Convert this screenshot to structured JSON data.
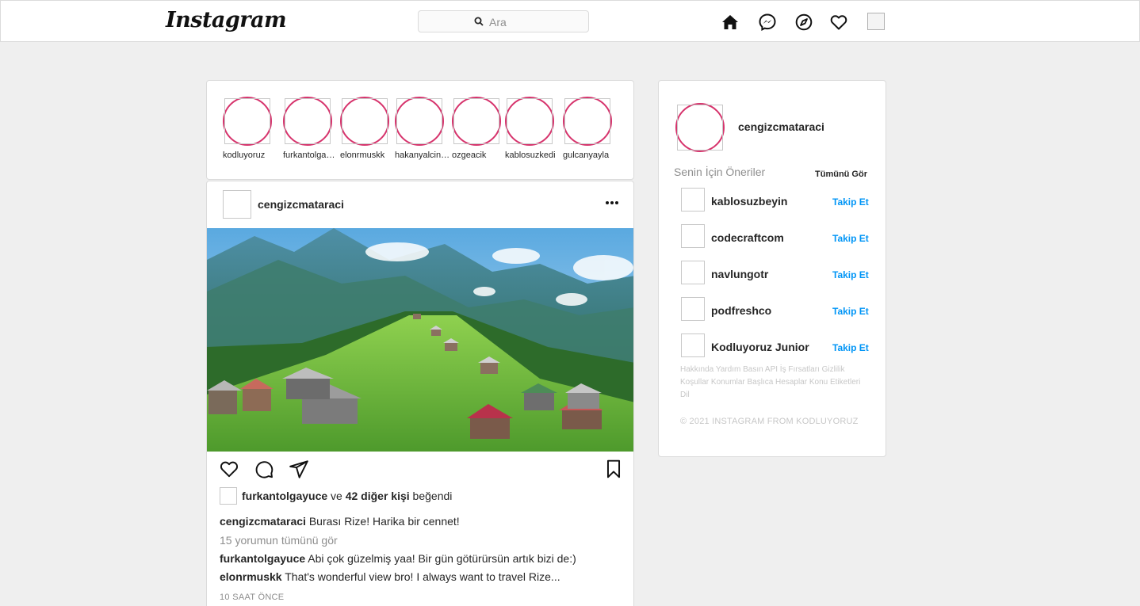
{
  "header": {
    "logo": "Instagram",
    "search_placeholder": "Ara"
  },
  "stories": [
    {
      "name": "kodluyoruz"
    },
    {
      "name": "furkantolgayuce"
    },
    {
      "name": "elonrmuskk"
    },
    {
      "name": "hakanyalcinkaya"
    },
    {
      "name": "ozgeacik"
    },
    {
      "name": "kablosuzkedi"
    },
    {
      "name": "gulcanyayla"
    }
  ],
  "post": {
    "author": "cengizcmataraci",
    "liked_by": "furkantolgayuce",
    "likes_and": "ve",
    "likes_others": "42 diğer kişi",
    "likes_suffix": "beğendi",
    "caption_user": "cengizcmataraci",
    "caption_text": "Burası Rize! Harika bir cennet!",
    "view_comments": "15 yorumun tümünü gör",
    "comments": [
      {
        "user": "furkantolgayuce",
        "text": "Abi çok güzelmiş yaa! Bir gün götürürsün artık bizi de:)"
      },
      {
        "user": "elonrmuskk",
        "text": "That's wonderful view bro! I always want to travel Rize..."
      }
    ],
    "time": "10 SAAT ÖNCE"
  },
  "sidebar": {
    "username": "cengizcmataraci",
    "suggestions_title": "Senin İçin Öneriler",
    "see_all": "Tümünü Gör",
    "follow_label": "Takip Et",
    "suggestions": [
      {
        "name": "kablosuzbeyin"
      },
      {
        "name": "codecraftcom"
      },
      {
        "name": "navlungotr"
      },
      {
        "name": "podfreshco"
      },
      {
        "name": "Kodluyoruz Junior"
      }
    ],
    "footer_links": "Hakkında Yardım Basın API İş Fırsatları Gizlilik Koşullar Konumlar Başlıca Hesaplar Konu Etiketleri Dil",
    "copyright": "© 2021 INSTAGRAM FROM KODLUYORUZ"
  },
  "colors": {
    "story_ring": "#d6336c",
    "link_blue": "#0095f6",
    "background": "#efefef"
  },
  "icons": [
    "search-icon",
    "home-icon",
    "messenger-icon",
    "explore-icon",
    "heart-icon",
    "more-icon",
    "like-icon",
    "comment-icon",
    "share-icon",
    "bookmark-icon"
  ]
}
